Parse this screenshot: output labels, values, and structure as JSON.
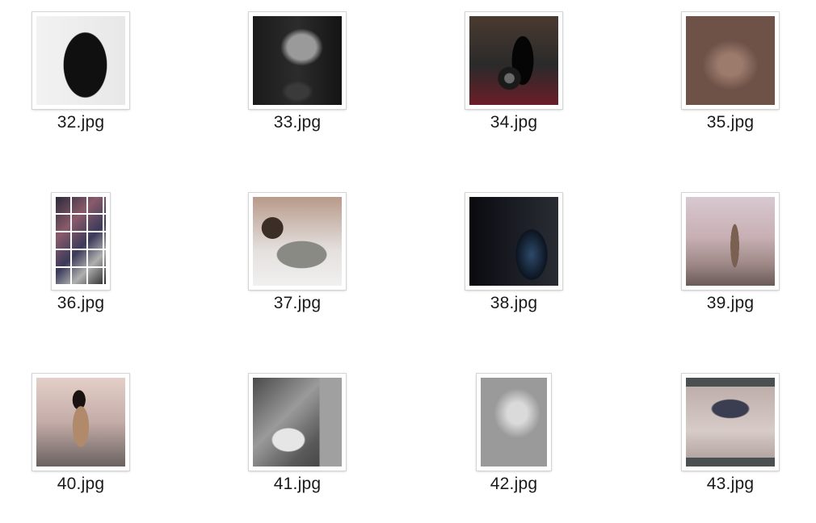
{
  "files": [
    {
      "name": "32.jpg",
      "thumb": "wide"
    },
    {
      "name": "33.jpg",
      "thumb": "wide"
    },
    {
      "name": "34.jpg",
      "thumb": "wide"
    },
    {
      "name": "35.jpg",
      "thumb": "wide"
    },
    {
      "name": "36.jpg",
      "thumb": "tall"
    },
    {
      "name": "37.jpg",
      "thumb": "wide"
    },
    {
      "name": "38.jpg",
      "thumb": "wide"
    },
    {
      "name": "39.jpg",
      "thumb": "wide"
    },
    {
      "name": "40.jpg",
      "thumb": "wide"
    },
    {
      "name": "41.jpg",
      "thumb": "wide"
    },
    {
      "name": "42.jpg",
      "thumb": "mid"
    },
    {
      "name": "43.jpg",
      "thumb": "wide"
    }
  ]
}
